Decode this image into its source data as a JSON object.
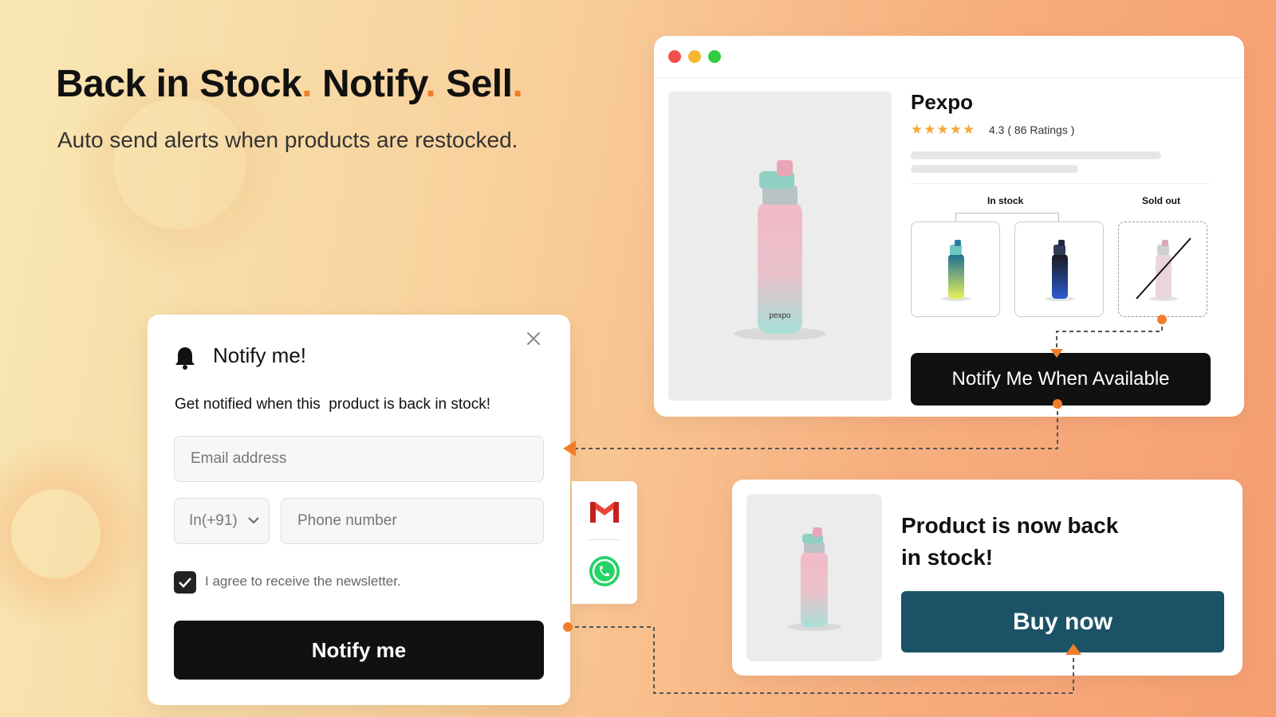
{
  "hero": {
    "headline_part1": "Back in Stock",
    "headline_part2": "Notify",
    "headline_part3": "Sell",
    "separator": ".",
    "subheadline": "Auto send alerts when products are restocked."
  },
  "product_page": {
    "product_name": "Pexpo",
    "stars": "★★★★★",
    "rating_text": "4.3 ( 86 Ratings )",
    "in_stock_label": "In stock",
    "sold_out_label": "Sold out",
    "brand_on_bottle": "pexpo",
    "notify_button": "Notify Me When Available",
    "window_dots": [
      "#f24e4e",
      "#f7b731",
      "#2ecc40"
    ]
  },
  "notify_modal": {
    "title": "Notify me!",
    "description": "Get notified when this  product is back in stock!",
    "email_placeholder": "Email address",
    "country_code": "In(+91)",
    "phone_placeholder": "Phone number",
    "newsletter_label": "I agree to receive the newsletter.",
    "newsletter_checked": true,
    "submit_button": "Notify me"
  },
  "channels": {
    "icons": [
      "gmail-icon",
      "whatsapp-icon"
    ]
  },
  "restock_card": {
    "title": "Product is now back in stock!",
    "buy_button": "Buy now"
  },
  "colors": {
    "accent_orange": "#f07d2a",
    "buy_button": "#1b5266",
    "dark_button": "#111111"
  }
}
